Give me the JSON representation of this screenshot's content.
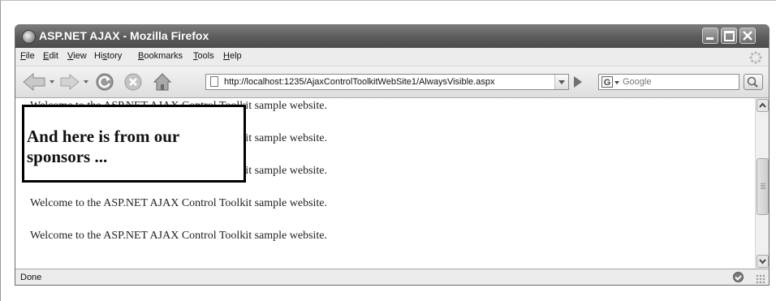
{
  "window": {
    "title": "ASP.NET AJAX - Mozilla Firefox",
    "icon": "firefox-icon",
    "controls": [
      "minimize-icon",
      "maximize-icon",
      "close-icon"
    ]
  },
  "menubar": {
    "items": [
      {
        "label": "File",
        "underline": "F"
      },
      {
        "label": "Edit",
        "underline": "E"
      },
      {
        "label": "View",
        "underline": "V"
      },
      {
        "label": "History",
        "underline": "s"
      },
      {
        "label": "Bookmarks",
        "underline": "B"
      },
      {
        "label": "Tools",
        "underline": "T"
      },
      {
        "label": "Help",
        "underline": "H"
      }
    ]
  },
  "navbar": {
    "url": "http://localhost:1235/AjaxControlToolkitWebSite1/AlwaysVisible.aspx",
    "search_placeholder": "Google",
    "icons": [
      "back-icon",
      "forward-icon",
      "reload-icon",
      "stop-icon",
      "home-icon",
      "go-icon",
      "search-icon"
    ]
  },
  "content": {
    "lines": [
      "Welcome to the ASP.NET AJAX Control Toolkit sample website.",
      "Welcome to the ASP.NET AJAX Control Toolkit sample website.",
      "Welcome to the ASP.NET AJAX Control Toolkit sample website.",
      "Welcome to the ASP.NET AJAX Control Toolkit sample website.",
      "Welcome to the ASP.NET AJAX Control Toolkit sample website."
    ],
    "always_visible_panel": "And here is from our sponsors ..."
  },
  "status": {
    "text": "Done"
  }
}
